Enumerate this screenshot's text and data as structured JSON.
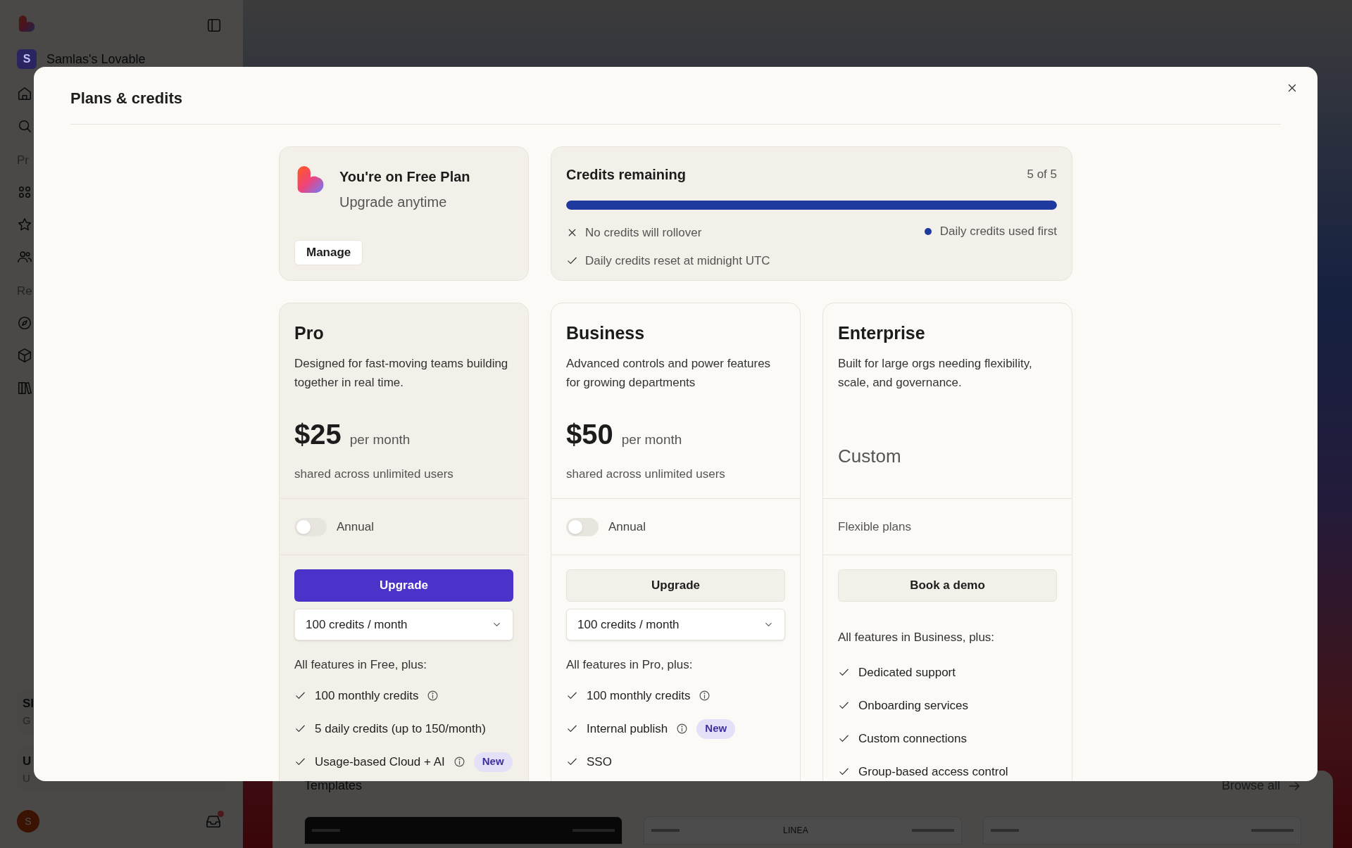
{
  "sidebar": {
    "workspace": {
      "initial": "S",
      "name": "Samlas's Lovable"
    },
    "section_labels": [
      "Pr",
      "Re"
    ],
    "cards": [
      {
        "title": "Sl",
        "subtitle": "G"
      },
      {
        "title": "U",
        "subtitle": "U"
      }
    ],
    "avatar": "S",
    "inbox_unread": true
  },
  "templates": {
    "title": "Templates",
    "link": "Browse all",
    "thumbnails": [
      {
        "kind": "dark"
      },
      {
        "kind": "light",
        "title": "LINEA"
      },
      {
        "kind": "light"
      }
    ]
  },
  "modal": {
    "title": "Plans & credits",
    "current_plan": {
      "title": "You're on Free Plan",
      "subtitle": "Upgrade anytime",
      "button": "Manage"
    },
    "credits": {
      "title": "Credits remaining",
      "count": "5 of 5",
      "level": 1,
      "notes": [
        {
          "kind": "cross",
          "text": "No credits will rollover"
        },
        {
          "kind": "check",
          "text": "Daily credits reset at midnight UTC"
        }
      ],
      "legend": {
        "text": "Daily credits used first",
        "color": "#1e3a9f"
      }
    },
    "plans": [
      {
        "name": "Pro",
        "highlighted": true,
        "description": "Designed for fast-moving teams building together in real time.",
        "price": "$25",
        "period": "per month",
        "note": "shared across unlimited users",
        "option": {
          "kind": "toggle",
          "label": "Annual",
          "on": false
        },
        "button": {
          "label": "Upgrade",
          "primary": true
        },
        "dropdown": "100 credits / month",
        "features_heading": "All features in Free, plus:",
        "features": [
          {
            "text": "100 monthly credits",
            "info": true
          },
          {
            "text": "5 daily credits (up to 150/month)",
            "info": false
          },
          {
            "text": "Usage-based Cloud + AI",
            "info": true,
            "badge": "New"
          }
        ]
      },
      {
        "name": "Business",
        "highlighted": false,
        "description": "Advanced controls and power features for growing departments",
        "price": "$50",
        "period": "per month",
        "note": "shared across unlimited users",
        "option": {
          "kind": "toggle",
          "label": "Annual",
          "on": false
        },
        "button": {
          "label": "Upgrade",
          "primary": false
        },
        "dropdown": "100 credits / month",
        "features_heading": "All features in Pro, plus:",
        "features": [
          {
            "text": "100 monthly credits",
            "info": true
          },
          {
            "text": "Internal publish",
            "info": true,
            "badge": "New"
          },
          {
            "text": "SSO",
            "info": false
          }
        ]
      },
      {
        "name": "Enterprise",
        "highlighted": false,
        "description": "Built for large orgs needing flexibility, scale, and governance.",
        "price": "Custom",
        "option": {
          "kind": "text",
          "label": "Flexible plans"
        },
        "button": {
          "label": "Book a demo",
          "primary": false
        },
        "features_heading": "All features in Business, plus:",
        "features": [
          {
            "text": "Dedicated support",
            "info": false
          },
          {
            "text": "Onboarding services",
            "info": false
          },
          {
            "text": "Custom connections",
            "info": false
          },
          {
            "text": "Group-based access control",
            "info": false
          }
        ]
      }
    ]
  }
}
